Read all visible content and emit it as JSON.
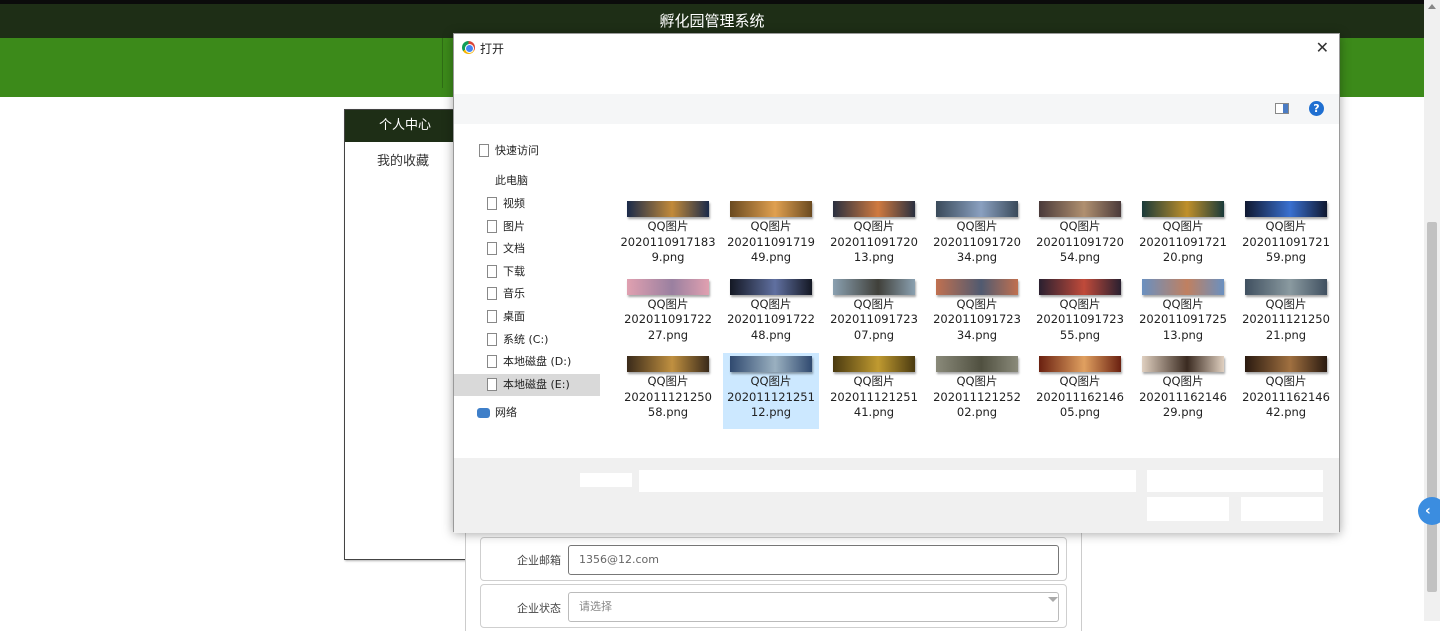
{
  "app": {
    "title": "孵化园管理系统"
  },
  "sidebar": {
    "header": "个人中心",
    "items": [
      {
        "label": "我的收藏"
      }
    ]
  },
  "form": {
    "email": {
      "label": "企业邮箱",
      "value": "1356@12.com"
    },
    "status": {
      "label": "企业状态",
      "placeholder": "请选择"
    }
  },
  "dialog": {
    "title": "打开",
    "nav": {
      "quick_access": "快速访问",
      "this_pc": "此电脑",
      "items": [
        {
          "label": "视频"
        },
        {
          "label": "图片"
        },
        {
          "label": "文档"
        },
        {
          "label": "下载"
        },
        {
          "label": "音乐"
        },
        {
          "label": "桌面"
        },
        {
          "label": "系统 (C:)"
        },
        {
          "label": "本地磁盘 (D:)"
        },
        {
          "label": "本地磁盘 (E:)",
          "selected": true
        }
      ],
      "network": "网络"
    },
    "files": [
      {
        "l1": "QQ图片",
        "l2": "2020110917183",
        "l3": "9.png",
        "colors": [
          "#1a2a4a",
          "#c28a3a"
        ]
      },
      {
        "l1": "QQ图片",
        "l2": "202011091719",
        "l3": "49.png",
        "colors": [
          "#6a4a20",
          "#e0a050"
        ]
      },
      {
        "l1": "QQ图片",
        "l2": "202011091720",
        "l3": "13.png",
        "colors": [
          "#2a3040",
          "#d07a40"
        ]
      },
      {
        "l1": "QQ图片",
        "l2": "202011091720",
        "l3": "34.png",
        "colors": [
          "#3a4a5a",
          "#8aa0c0"
        ]
      },
      {
        "l1": "QQ图片",
        "l2": "202011091720",
        "l3": "54.png",
        "colors": [
          "#4a3a3a",
          "#b09070"
        ]
      },
      {
        "l1": "QQ图片",
        "l2": "202011091721",
        "l3": "20.png",
        "colors": [
          "#1a3a3a",
          "#c0902a"
        ]
      },
      {
        "l1": "QQ图片",
        "l2": "202011091721",
        "l3": "59.png",
        "colors": [
          "#101830",
          "#3a70d0"
        ]
      },
      {
        "l1": "QQ图片",
        "l2": "202011091722",
        "l3": "27.png",
        "colors": [
          "#e0a0b0",
          "#9a80a0"
        ]
      },
      {
        "l1": "QQ图片",
        "l2": "202011091722",
        "l3": "48.png",
        "colors": [
          "#141824",
          "#6070a0"
        ]
      },
      {
        "l1": "QQ图片",
        "l2": "202011091723",
        "l3": "07.png",
        "colors": [
          "#8aa0b0",
          "#40403a"
        ]
      },
      {
        "l1": "QQ图片",
        "l2": "202011091723",
        "l3": "34.png",
        "colors": [
          "#c07050",
          "#505a70"
        ]
      },
      {
        "l1": "QQ图片",
        "l2": "202011091723",
        "l3": "55.png",
        "colors": [
          "#2a2030",
          "#c04a3a"
        ]
      },
      {
        "l1": "QQ图片",
        "l2": "202011091725",
        "l3": "13.png",
        "colors": [
          "#6a90c0",
          "#c08060"
        ]
      },
      {
        "l1": "QQ图片",
        "l2": "202011121250",
        "l3": "21.png",
        "colors": [
          "#405060",
          "#8a9aa0"
        ]
      },
      {
        "l1": "QQ图片",
        "l2": "202011121250",
        "l3": "58.png",
        "colors": [
          "#3a2a1a",
          "#c09040"
        ]
      },
      {
        "l1": "QQ图片",
        "l2": "202011121251",
        "l3": "12.png",
        "colors": [
          "#304a70",
          "#9ab0c0"
        ],
        "selected": true
      },
      {
        "l1": "QQ图片",
        "l2": "202011121251",
        "l3": "41.png",
        "colors": [
          "#4a3a10",
          "#c09a30"
        ]
      },
      {
        "l1": "QQ图片",
        "l2": "202011121252",
        "l3": "02.png",
        "colors": [
          "#8a8a7a",
          "#505040"
        ]
      },
      {
        "l1": "QQ图片",
        "l2": "202011162146",
        "l3": "05.png",
        "colors": [
          "#6a2010",
          "#e0a060"
        ]
      },
      {
        "l1": "QQ图片",
        "l2": "202011162146",
        "l3": "29.png",
        "colors": [
          "#e0d0c0",
          "#3a2a20"
        ]
      },
      {
        "l1": "QQ图片",
        "l2": "202011162146",
        "l3": "42.png",
        "colors": [
          "#2a1a10",
          "#a07040"
        ]
      }
    ]
  }
}
